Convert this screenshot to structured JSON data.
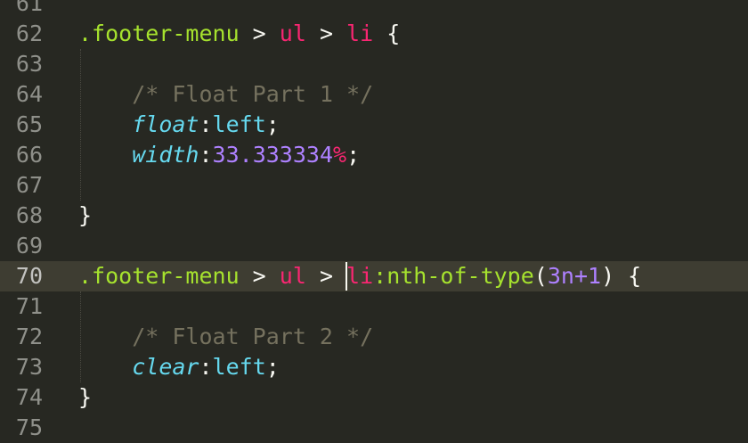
{
  "editor": {
    "lines": [
      {
        "num": "61",
        "tokens": []
      },
      {
        "num": "62",
        "tokens": [
          {
            "t": ".footer-menu",
            "c": "cls"
          },
          {
            "t": " > ",
            "c": "op"
          },
          {
            "t": "ul",
            "c": "tag"
          },
          {
            "t": " > ",
            "c": "op"
          },
          {
            "t": "li",
            "c": "tag"
          },
          {
            "t": " {",
            "c": "pl"
          }
        ]
      },
      {
        "num": "63",
        "tokens": []
      },
      {
        "num": "64",
        "tokens": [
          {
            "t": "    /* Float Part 1 */",
            "c": "com"
          }
        ]
      },
      {
        "num": "65",
        "tokens": [
          {
            "t": "    ",
            "c": "pl"
          },
          {
            "t": "float",
            "c": "prop"
          },
          {
            "t": ":",
            "c": "pl"
          },
          {
            "t": "left",
            "c": "val"
          },
          {
            "t": ";",
            "c": "pl"
          }
        ]
      },
      {
        "num": "66",
        "tokens": [
          {
            "t": "    ",
            "c": "pl"
          },
          {
            "t": "width",
            "c": "prop"
          },
          {
            "t": ":",
            "c": "pl"
          },
          {
            "t": "33.333334",
            "c": "num"
          },
          {
            "t": "%",
            "c": "unit"
          },
          {
            "t": ";",
            "c": "pl"
          }
        ]
      },
      {
        "num": "67",
        "tokens": []
      },
      {
        "num": "68",
        "tokens": [
          {
            "t": "}",
            "c": "pl"
          }
        ]
      },
      {
        "num": "69",
        "tokens": []
      },
      {
        "num": "70",
        "tokens": [
          {
            "t": ".footer-menu",
            "c": "cls"
          },
          {
            "t": " > ",
            "c": "op"
          },
          {
            "t": "ul",
            "c": "tag"
          },
          {
            "t": " > ",
            "c": "op"
          },
          {
            "t": "li",
            "c": "tag"
          },
          {
            "t": ":nth-of-type",
            "c": "pc"
          },
          {
            "t": "(",
            "c": "pl"
          },
          {
            "t": "3n+1",
            "c": "num"
          },
          {
            "t": ") {",
            "c": "pl"
          }
        ]
      },
      {
        "num": "71",
        "tokens": []
      },
      {
        "num": "72",
        "tokens": [
          {
            "t": "    /* Float Part 2 */",
            "c": "com"
          }
        ]
      },
      {
        "num": "73",
        "tokens": [
          {
            "t": "    ",
            "c": "pl"
          },
          {
            "t": "clear",
            "c": "prop"
          },
          {
            "t": ":",
            "c": "pl"
          },
          {
            "t": "left",
            "c": "val"
          },
          {
            "t": ";",
            "c": "pl"
          }
        ]
      },
      {
        "num": "74",
        "tokens": [
          {
            "t": "}",
            "c": "pl"
          }
        ]
      },
      {
        "num": "75",
        "tokens": []
      }
    ],
    "active_line": "70",
    "colors": {
      "background": "#272822",
      "active_line_bg": "#3e3d32",
      "gutter_text": "#8f908a",
      "selector": "#a6e22e",
      "tag": "#f92672",
      "comment": "#75715e",
      "property": "#66d9ef",
      "number": "#ae81ff",
      "text": "#f8f8f2"
    }
  }
}
